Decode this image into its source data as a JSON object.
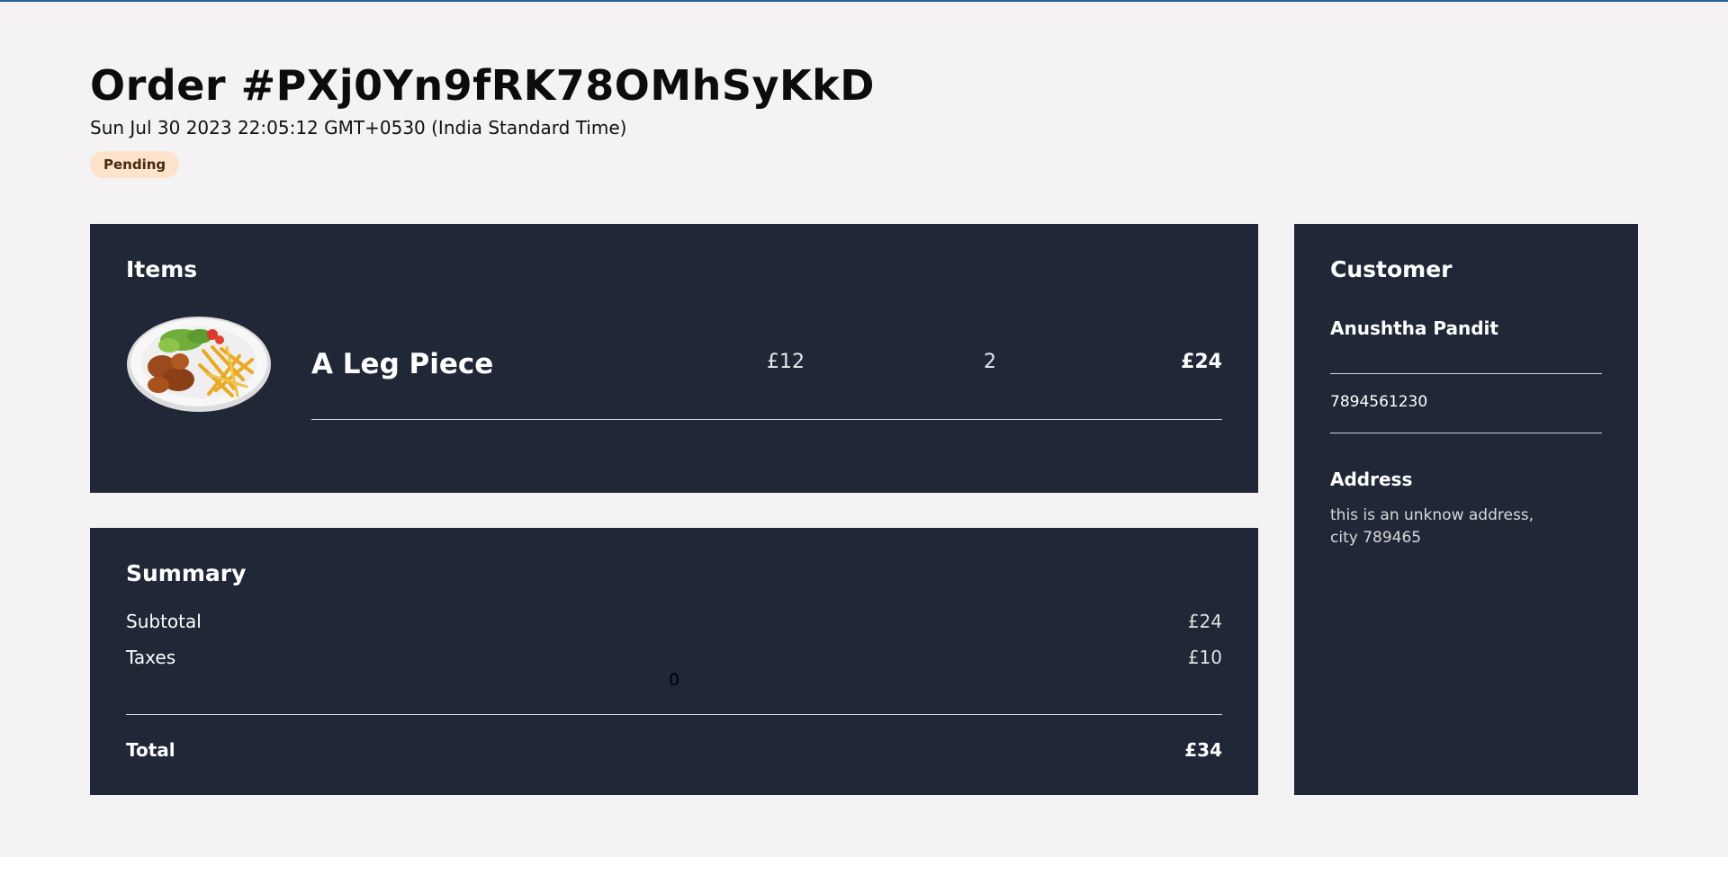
{
  "order": {
    "title": "Order #PXj0Yn9fRK78OMhSyKkD",
    "date": "Sun Jul 30 2023 22:05:12 GMT+0530 (India Standard Time)",
    "status": "Pending"
  },
  "items_section": {
    "title": "Items",
    "items": [
      {
        "name": "A Leg Piece",
        "price": "£12",
        "quantity": "2",
        "total": "£24",
        "image_icon": "chicken-fries-plate-image"
      }
    ]
  },
  "summary": {
    "title": "Summary",
    "subtotal_label": "Subtotal",
    "subtotal_value": "£24",
    "taxes_label": "Taxes",
    "taxes_value": "£10",
    "stray_value": "0",
    "total_label": "Total",
    "total_value": "£34"
  },
  "customer": {
    "title": "Customer",
    "name": "Anushtha Pandit",
    "phone": "7894561230",
    "address_heading": "Address",
    "address_line1": "this is an unknow address,",
    "address_line2": "city 789465"
  },
  "colors": {
    "page_bg": "#f4f2f3",
    "card_bg": "#202838",
    "badge_bg": "#fde3cc",
    "top_accent": "#2c5d9c"
  }
}
